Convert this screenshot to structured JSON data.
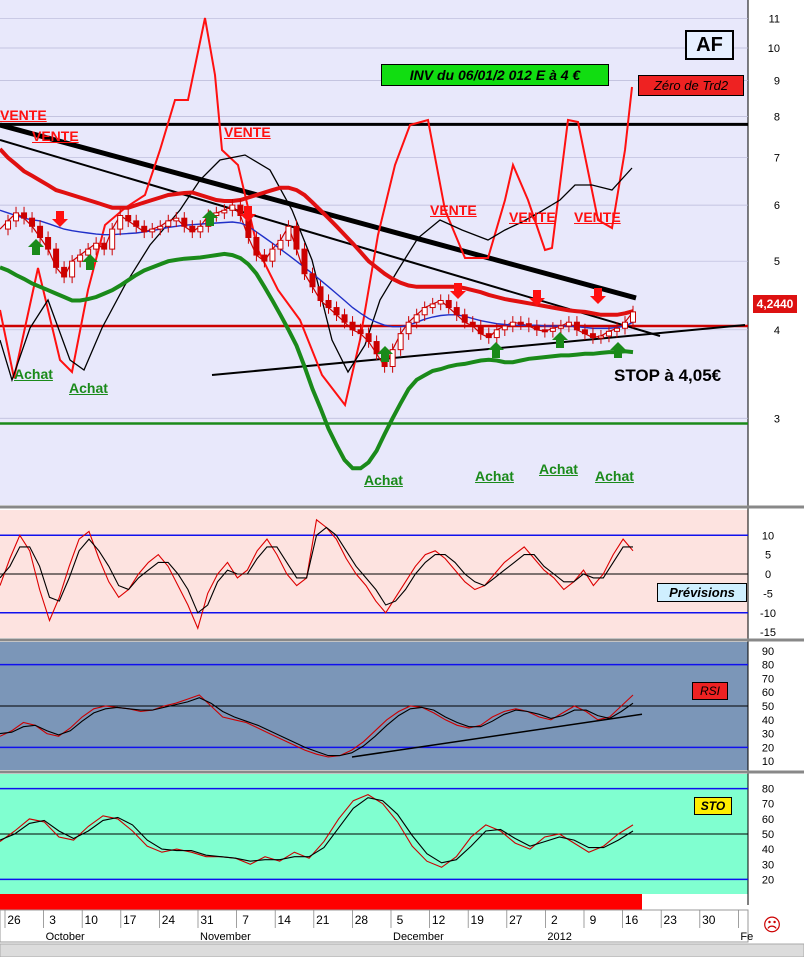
{
  "window": {
    "ticker": "AF"
  },
  "annotations": {
    "inv": "INV du 06/01/2 012     E à  4 €",
    "zero_trd2": "Zéro de Trd2",
    "last_price": "4,2440",
    "stop": "STOP à 4,05€",
    "vente": [
      "VENTE",
      "VENTE",
      "VENTE",
      "VENTE",
      "VENTE",
      "VENTE"
    ],
    "achat": [
      "Achat",
      "Achat",
      "Achat",
      "Achat",
      "Achat",
      "Achat"
    ]
  },
  "panel_labels": {
    "previsions": "Prévisions",
    "rsi": "RSI",
    "sto": "STO"
  },
  "colors": {
    "main_bg": "#e8e8fb",
    "prev_bg": "#fde3e0",
    "rsi_bg": "#7b96b8",
    "sto_bg": "#80ffd0",
    "sell": "#ff1010",
    "buy": "#1a8a1a",
    "date_bar": "#ff0000"
  },
  "icons": {
    "smiley": "sad-face-icon"
  },
  "chart_data": [
    {
      "type": "line",
      "panel": "price",
      "yscale": "log",
      "ylim": [
        2.3,
        11.5
      ],
      "yticks": [
        3,
        4,
        5,
        6,
        7,
        8,
        9,
        10,
        11
      ],
      "xticks": [
        {
          "day": "26",
          "month": ""
        },
        {
          "day": "3",
          "month": "October"
        },
        {
          "day": "10",
          "month": ""
        },
        {
          "day": "17",
          "month": ""
        },
        {
          "day": "24",
          "month": ""
        },
        {
          "day": "31",
          "month": "November"
        },
        {
          "day": "7",
          "month": ""
        },
        {
          "day": "14",
          "month": ""
        },
        {
          "day": "21",
          "month": ""
        },
        {
          "day": "28",
          "month": ""
        },
        {
          "day": "5",
          "month": "December"
        },
        {
          "day": "12",
          "month": ""
        },
        {
          "day": "19",
          "month": ""
        },
        {
          "day": "27",
          "month": ""
        },
        {
          "day": "2",
          "month": "2012"
        },
        {
          "day": "9",
          "month": ""
        },
        {
          "day": "16",
          "month": ""
        },
        {
          "day": "23",
          "month": ""
        },
        {
          "day": "30",
          "month": ""
        },
        {
          "day": "",
          "month": "Fe"
        }
      ],
      "horizontal_levels": [
        {
          "value": 7.8,
          "color": "#000000"
        },
        {
          "value": 4.05,
          "color": "#cc0000"
        },
        {
          "value": 2.95,
          "color": "#1a8a1a"
        }
      ],
      "series": [
        {
          "color": "#cc0000",
          "role": "close",
          "values": [
            5.55,
            5.7,
            5.85,
            5.75,
            5.6,
            5.4,
            5.2,
            4.9,
            4.75,
            5.0,
            5.1,
            5.2,
            5.3,
            5.2,
            5.55,
            5.8,
            5.7,
            5.6,
            5.5,
            5.55,
            5.6,
            5.7,
            5.75,
            5.6,
            5.5,
            5.6,
            5.8,
            5.85,
            5.9,
            6.0,
            5.8,
            5.4,
            5.1,
            5.0,
            5.2,
            5.35,
            5.6,
            5.2,
            4.8,
            4.6,
            4.4,
            4.3,
            4.2,
            4.1,
            4.0,
            3.95,
            3.85,
            3.7,
            3.55,
            3.75,
            3.95,
            4.1,
            4.2,
            4.3,
            4.35,
            4.4,
            4.3,
            4.2,
            4.1,
            4.05,
            3.95,
            3.9,
            4.0,
            4.05,
            4.1,
            4.08,
            4.05,
            4.0,
            3.98,
            4.02,
            4.05,
            4.1,
            4.0,
            3.95,
            3.9,
            3.92,
            3.98,
            4.02,
            4.1,
            4.24
          ]
        },
        {
          "color": "#2030c8",
          "role": "moving average",
          "values": [
            5.9,
            5.85,
            5.8,
            5.75,
            5.72,
            5.7,
            5.65,
            5.6,
            5.55,
            5.52,
            5.5,
            5.48,
            5.46,
            5.45,
            5.45,
            5.46,
            5.47,
            5.48,
            5.5,
            5.52,
            5.55,
            5.58,
            5.6,
            5.62,
            5.63,
            5.64,
            5.65,
            5.66,
            5.67,
            5.68,
            5.66,
            5.6,
            5.5,
            5.4,
            5.3,
            5.2,
            5.1,
            5.0,
            4.9,
            4.8,
            4.7,
            4.6,
            4.5,
            4.4,
            4.3,
            4.22,
            4.15,
            4.1,
            4.06,
            4.04,
            4.04,
            4.06,
            4.1,
            4.14,
            4.17,
            4.19,
            4.2,
            4.2,
            4.18,
            4.15,
            4.12,
            4.1,
            4.08,
            4.07,
            4.06,
            4.06,
            4.06,
            4.06,
            4.05,
            4.05,
            4.05,
            4.05,
            4.04,
            4.03,
            4.02,
            4.02,
            4.02,
            4.03,
            4.05,
            4.1
          ]
        },
        {
          "color": "#e01010",
          "role": "upper band",
          "values": [
            7.2,
            7.0,
            6.85,
            6.7,
            6.6,
            6.5,
            6.4,
            6.3,
            6.25,
            6.2,
            6.15,
            6.1,
            6.05,
            6.0,
            5.95,
            5.95,
            5.95,
            6.0,
            6.05,
            6.1,
            6.15,
            6.2,
            6.22,
            6.24,
            6.25,
            6.2,
            6.15,
            6.1,
            6.08,
            6.08,
            6.1,
            6.15,
            6.2,
            6.25,
            6.3,
            6.35,
            6.35,
            6.3,
            6.2,
            6.05,
            5.9,
            5.75,
            5.6,
            5.45,
            5.3,
            5.15,
            5.0,
            4.9,
            4.8,
            4.72,
            4.66,
            4.62,
            4.6,
            4.6,
            4.6,
            4.6,
            4.6,
            4.6,
            4.58,
            4.55,
            4.52,
            4.48,
            4.45,
            4.42,
            4.4,
            4.38,
            4.36,
            4.34,
            4.32,
            4.3,
            4.28,
            4.26,
            4.25,
            4.24,
            4.22,
            4.2,
            4.2,
            4.2,
            4.22,
            4.25
          ]
        },
        {
          "color": "#1a8a1a",
          "role": "lower band",
          "values": [
            4.9,
            4.85,
            4.78,
            4.72,
            4.65,
            4.6,
            4.55,
            4.5,
            4.45,
            4.4,
            4.4,
            4.42,
            4.45,
            4.5,
            4.55,
            4.62,
            4.7,
            4.78,
            4.85,
            4.9,
            4.95,
            5.0,
            5.02,
            5.04,
            5.05,
            5.06,
            5.08,
            5.1,
            5.12,
            5.1,
            5.05,
            4.95,
            4.8,
            4.6,
            4.4,
            4.2,
            4.0,
            3.8,
            3.55,
            3.3,
            3.1,
            2.9,
            2.75,
            2.62,
            2.55,
            2.55,
            2.6,
            2.7,
            2.85,
            3.0,
            3.15,
            3.3,
            3.4,
            3.45,
            3.5,
            3.52,
            3.55,
            3.57,
            3.58,
            3.6,
            3.62,
            3.63,
            3.62,
            3.6,
            3.6,
            3.62,
            3.64,
            3.65,
            3.66,
            3.67,
            3.68,
            3.68,
            3.69,
            3.7,
            3.7,
            3.71,
            3.72,
            3.72,
            3.73,
            3.72
          ]
        }
      ]
    },
    {
      "type": "line",
      "panel": "previsions",
      "ylim": [
        -16,
        16
      ],
      "yticks": [
        10,
        5,
        0,
        -5,
        -10,
        -15
      ],
      "series": [
        {
          "color": "#dd0000",
          "values": [
            -3,
            4,
            10,
            6,
            -4,
            -12,
            -6,
            2,
            9,
            11,
            4,
            -2,
            -6,
            -4,
            0,
            3,
            5,
            2,
            -3,
            -8,
            -14,
            -5,
            0,
            3,
            -1,
            1,
            6,
            9,
            5,
            0,
            -3,
            -1,
            14,
            12,
            9,
            4,
            0,
            -3,
            -7,
            -10,
            -6,
            -2,
            2,
            5,
            6,
            4,
            1,
            -2,
            -4,
            -3,
            0,
            3,
            5,
            7,
            4,
            1,
            -1,
            -4,
            -2,
            1,
            -3,
            0,
            5,
            9,
            6
          ]
        },
        {
          "color": "#000000",
          "values": [
            -1,
            2,
            7,
            7,
            2,
            -6,
            -7,
            -1,
            6,
            9,
            6,
            2,
            -3,
            -4,
            -1,
            1,
            3,
            3,
            0,
            -4,
            -10,
            -8,
            -2,
            1,
            0,
            0,
            4,
            7,
            7,
            3,
            -1,
            -1,
            10,
            12,
            10,
            6,
            2,
            -1,
            -4,
            -8,
            -7,
            -4,
            0,
            3,
            5,
            5,
            3,
            0,
            -2,
            -3,
            -1,
            1,
            3,
            5,
            5,
            2,
            0,
            -2,
            -2,
            0,
            -1,
            -1,
            3,
            7,
            7
          ]
        }
      ]
    },
    {
      "type": "line",
      "panel": "rsi",
      "ylim": [
        5,
        95
      ],
      "yticks": [
        90,
        80,
        70,
        60,
        50,
        40,
        30,
        20,
        10
      ],
      "series": [
        {
          "color": "#cc0000",
          "values": [
            28,
            32,
            38,
            36,
            30,
            28,
            34,
            42,
            48,
            50,
            49,
            48,
            46,
            47,
            50,
            52,
            55,
            58,
            50,
            42,
            40,
            38,
            34,
            30,
            26,
            22,
            18,
            15,
            13,
            14,
            18,
            24,
            32,
            40,
            46,
            50,
            49,
            45,
            40,
            36,
            34,
            36,
            42,
            46,
            48,
            46,
            42,
            40,
            45,
            50,
            46,
            40,
            42,
            50,
            58
          ]
        },
        {
          "color": "#000000",
          "values": [
            30,
            31,
            35,
            36,
            32,
            29,
            32,
            39,
            45,
            48,
            49,
            48,
            47,
            47,
            49,
            51,
            53,
            56,
            52,
            46,
            42,
            39,
            36,
            32,
            28,
            24,
            20,
            17,
            14,
            14,
            16,
            21,
            28,
            36,
            43,
            48,
            49,
            47,
            42,
            38,
            35,
            35,
            39,
            44,
            47,
            46,
            44,
            41,
            43,
            47,
            47,
            43,
            41,
            46,
            52
          ]
        }
      ]
    },
    {
      "type": "line",
      "panel": "sto",
      "ylim": [
        13,
        87
      ],
      "yticks": [
        80,
        70,
        60,
        50,
        40,
        30,
        20
      ],
      "series": [
        {
          "color": "#cc0000",
          "values": [
            45,
            52,
            60,
            58,
            48,
            46,
            55,
            62,
            60,
            52,
            42,
            38,
            40,
            38,
            35,
            35,
            34,
            30,
            35,
            32,
            38,
            34,
            45,
            60,
            72,
            76,
            70,
            58,
            42,
            32,
            28,
            35,
            48,
            56,
            52,
            44,
            40,
            48,
            50,
            44,
            38,
            42,
            50,
            56
          ]
        },
        {
          "color": "#000000",
          "values": [
            46,
            50,
            57,
            59,
            52,
            47,
            52,
            59,
            61,
            56,
            46,
            40,
            39,
            39,
            36,
            35,
            34,
            32,
            33,
            33,
            35,
            35,
            41,
            54,
            67,
            74,
            72,
            63,
            49,
            37,
            31,
            33,
            42,
            52,
            53,
            47,
            42,
            45,
            48,
            46,
            41,
            41,
            46,
            52
          ]
        }
      ]
    }
  ]
}
